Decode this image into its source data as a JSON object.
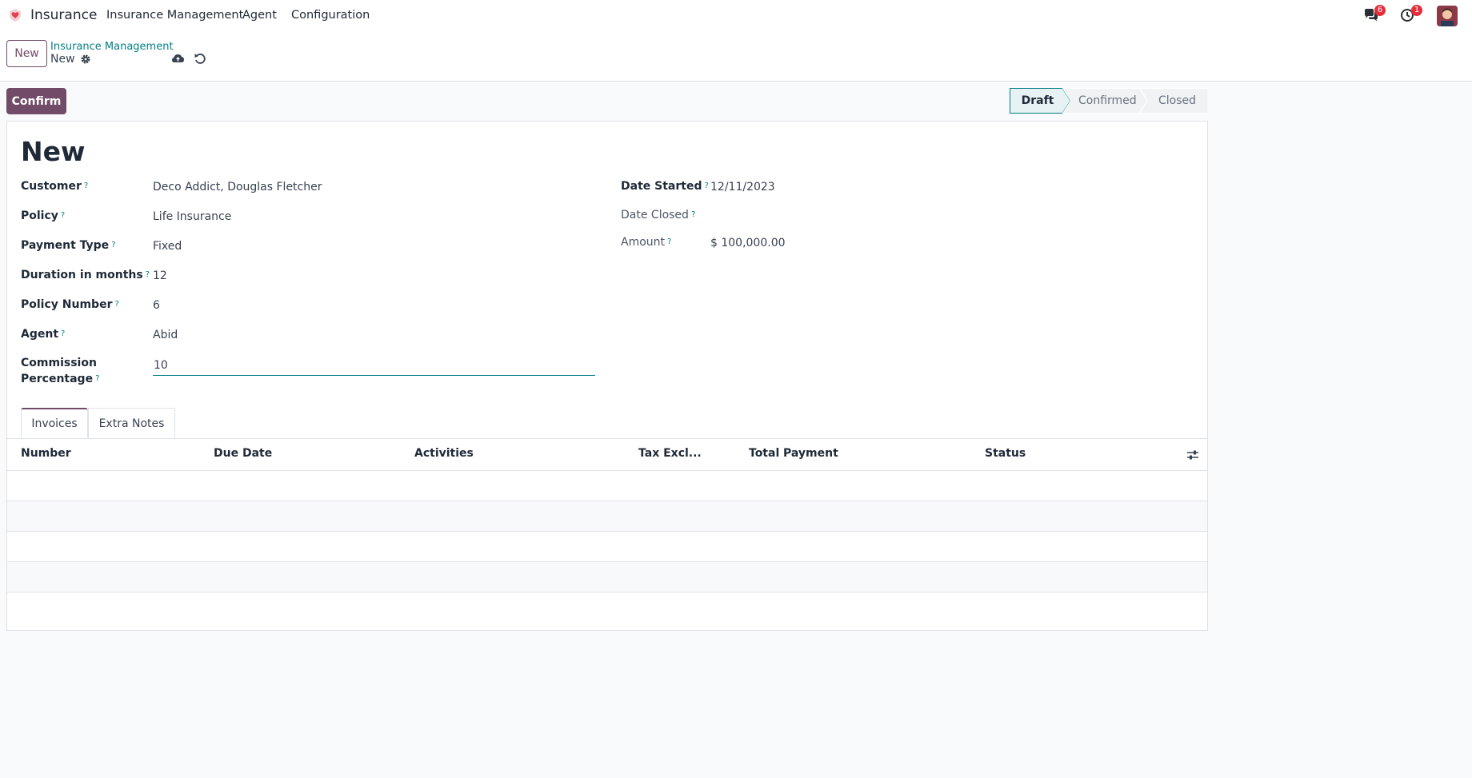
{
  "navbar": {
    "app_name": "Insurance",
    "menu": [
      "Insurance Management",
      "Agent",
      "Configuration"
    ],
    "messages_badge": "6",
    "activities_badge": "1",
    "brand_color": "#714b67"
  },
  "control_panel": {
    "new_label": "New",
    "breadcrumb_parent": "Insurance Management",
    "breadcrumb_current": "New"
  },
  "statusbar": {
    "confirm_label": "Confirm",
    "stages": [
      "Draft",
      "Confirmed",
      "Closed"
    ],
    "active_stage": "Draft"
  },
  "form": {
    "title": "New",
    "left_fields": [
      {
        "label": "Customer",
        "value": "Deco Addict, Douglas Fletcher"
      },
      {
        "label": "Policy",
        "value": "Life Insurance"
      },
      {
        "label": "Payment Type",
        "value": "Fixed"
      },
      {
        "label": "Duration in months",
        "value": "12"
      },
      {
        "label": "Policy Number",
        "value": "6"
      },
      {
        "label": "Agent",
        "value": "Abid"
      }
    ],
    "commission": {
      "label_line1": "Commission",
      "label_line2": "Percentage",
      "value": "10"
    },
    "right_fields": [
      {
        "label": "Date Started",
        "value": "12/11/2023"
      },
      {
        "label": "Date Closed",
        "value": ""
      },
      {
        "label": "Amount",
        "value": "$ 100,000.00"
      }
    ],
    "help_mark": "?"
  },
  "tabs": [
    {
      "label": "Invoices",
      "active": true
    },
    {
      "label": "Extra Notes",
      "active": false
    }
  ],
  "table": {
    "columns": [
      "Number",
      "Due Date",
      "Activities",
      "Tax Excl...",
      "Total",
      "Payment",
      "Status"
    ],
    "rows": []
  }
}
